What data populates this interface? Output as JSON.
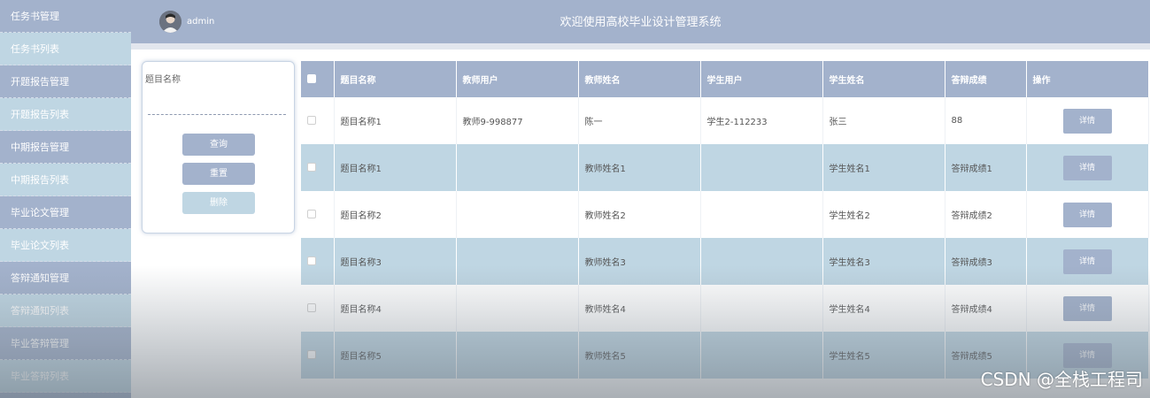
{
  "sidebar": {
    "items": [
      {
        "label": "任务书管理"
      },
      {
        "label": "任务书列表"
      },
      {
        "label": "开题报告管理"
      },
      {
        "label": "开题报告列表"
      },
      {
        "label": "中期报告管理"
      },
      {
        "label": "中期报告列表"
      },
      {
        "label": "毕业论文管理"
      },
      {
        "label": "毕业论文列表"
      },
      {
        "label": "答辩通知管理"
      },
      {
        "label": "答辩通知列表"
      },
      {
        "label": "毕业答辩管理"
      },
      {
        "label": "毕业答辩列表"
      }
    ]
  },
  "header": {
    "username": "admin",
    "title": "欢迎使用高校毕业设计管理系统"
  },
  "search": {
    "label": "题目名称",
    "value": "",
    "query_label": "查询",
    "reset_label": "重置",
    "delete_label": "删除"
  },
  "table": {
    "columns": [
      "题目名称",
      "教师用户",
      "教师姓名",
      "学生用户",
      "学生姓名",
      "答辩成绩",
      "操作"
    ],
    "detail_label": "详情",
    "rows": [
      {
        "title": "题目名称1",
        "teacher_user": "教师9-998877",
        "teacher_name": "陈一",
        "student_user": "学生2-112233",
        "student_name": "张三",
        "score": "88"
      },
      {
        "title": "题目名称1",
        "teacher_user": "",
        "teacher_name": "教师姓名1",
        "student_user": "",
        "student_name": "学生姓名1",
        "score": "答辩成绩1"
      },
      {
        "title": "题目名称2",
        "teacher_user": "",
        "teacher_name": "教师姓名2",
        "student_user": "",
        "student_name": "学生姓名2",
        "score": "答辩成绩2"
      },
      {
        "title": "题目名称3",
        "teacher_user": "",
        "teacher_name": "教师姓名3",
        "student_user": "",
        "student_name": "学生姓名3",
        "score": "答辩成绩3"
      },
      {
        "title": "题目名称4",
        "teacher_user": "",
        "teacher_name": "教师姓名4",
        "student_user": "",
        "student_name": "学生姓名4",
        "score": "答辩成绩4"
      },
      {
        "title": "题目名称5",
        "teacher_user": "",
        "teacher_name": "教师姓名5",
        "student_user": "",
        "student_name": "学生姓名5",
        "score": "答辩成绩5"
      }
    ]
  },
  "watermark": "CSDN @全栈工程司",
  "colors": {
    "primary": "#a3b2cc",
    "secondary": "#bfd6e3"
  }
}
